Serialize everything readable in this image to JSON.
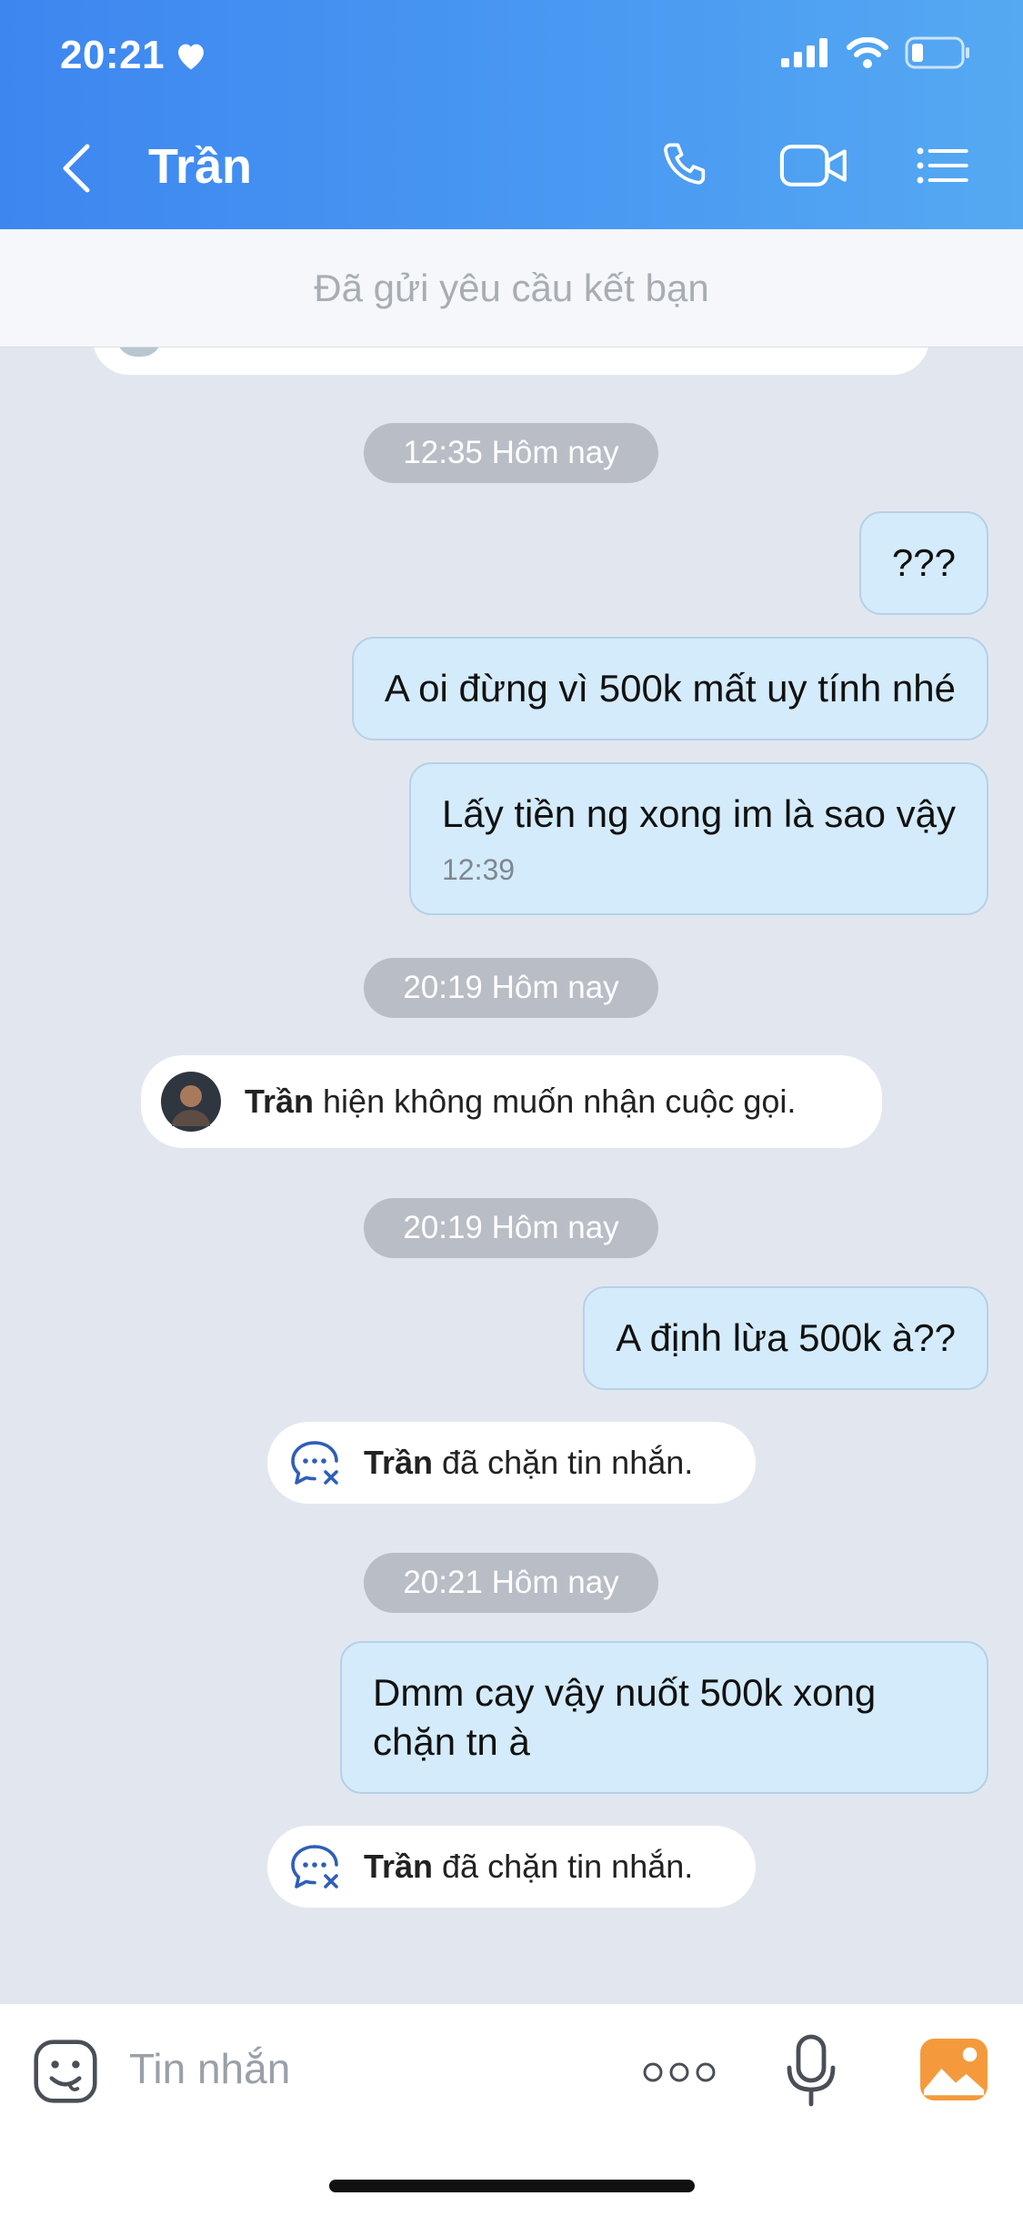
{
  "status_bar": {
    "time": "20:21"
  },
  "header": {
    "contact_name": "Trần"
  },
  "banner": {
    "text": "Đã gửi yêu cầu kết bạn"
  },
  "messages": [
    {
      "type": "time",
      "text": "12:35 Hôm nay"
    },
    {
      "type": "sent",
      "text": "???"
    },
    {
      "type": "sent",
      "text": "A oi đừng vì 500k mất uy tính nhé"
    },
    {
      "type": "sent",
      "text": "Lấy tiền ng xong im là sao vậy",
      "time": "12:39"
    },
    {
      "type": "time",
      "text": "20:19 Hôm nay"
    },
    {
      "type": "notice",
      "name": "Trần",
      "text": "hiện không muốn nhận cuộc gọi."
    },
    {
      "type": "time",
      "text": "20:19 Hôm nay"
    },
    {
      "type": "sent",
      "text": "A định lừa 500k à??"
    },
    {
      "type": "notice",
      "name": "Trần",
      "text": "đã chặn tin nhắn."
    },
    {
      "type": "time",
      "text": "20:21 Hôm nay"
    },
    {
      "type": "sent",
      "text": "Dmm cay vậy nuốt 500k xong chặn tn à"
    },
    {
      "type": "notice",
      "name": "Trần",
      "text": "đã chặn tin nhắn."
    }
  ],
  "input": {
    "placeholder": "Tin nhắn"
  },
  "colors": {
    "header_start": "#3d86f0",
    "header_end": "#55a9f2",
    "bubble_sent": "#d4ebfb",
    "chat_bg": "#e2e7ef"
  },
  "icons": [
    "heart-icon",
    "signal-icon",
    "wifi-icon",
    "battery-icon",
    "back-icon",
    "phone-icon",
    "video-icon",
    "menu-icon",
    "blocked-message-icon",
    "sticker-icon",
    "more-icon",
    "microphone-icon",
    "image-icon"
  ]
}
